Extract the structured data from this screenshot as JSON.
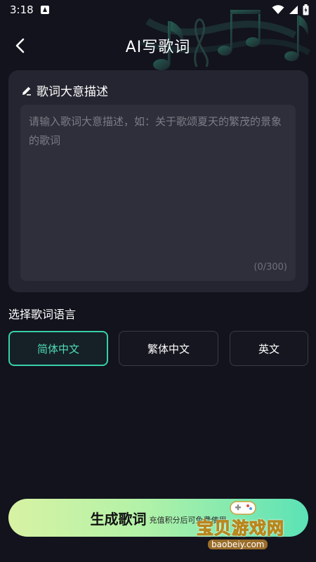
{
  "status_bar": {
    "time": "3:18",
    "icons": [
      "notification-icon",
      "wifi-icon",
      "signal-icon",
      "battery-icon"
    ]
  },
  "header": {
    "title": "AI写歌词",
    "back_icon": "chevron-left-icon"
  },
  "description_card": {
    "icon": "pencil-icon",
    "title": "歌词大意描述",
    "input_value": "",
    "placeholder": "请输入歌词大意描述，如：关于歌颂夏天的繁茂的景象的歌词",
    "counter": "(0/300)"
  },
  "language": {
    "label": "选择歌词语言",
    "options": [
      {
        "label": "简体中文",
        "selected": true
      },
      {
        "label": "繁体中文",
        "selected": false
      },
      {
        "label": "英文",
        "selected": false
      }
    ]
  },
  "generate": {
    "label": "生成歌词",
    "sub_label": "充值积分后可免费使用"
  },
  "watermark": {
    "text": "宝贝游戏网",
    "url": "baobeiy.com"
  },
  "colors": {
    "background": "#12131d",
    "card": "#242530",
    "accent": "#38d0a8",
    "button_gradient_start": "#d8f2a3",
    "button_gradient_end": "#5be2b6"
  }
}
